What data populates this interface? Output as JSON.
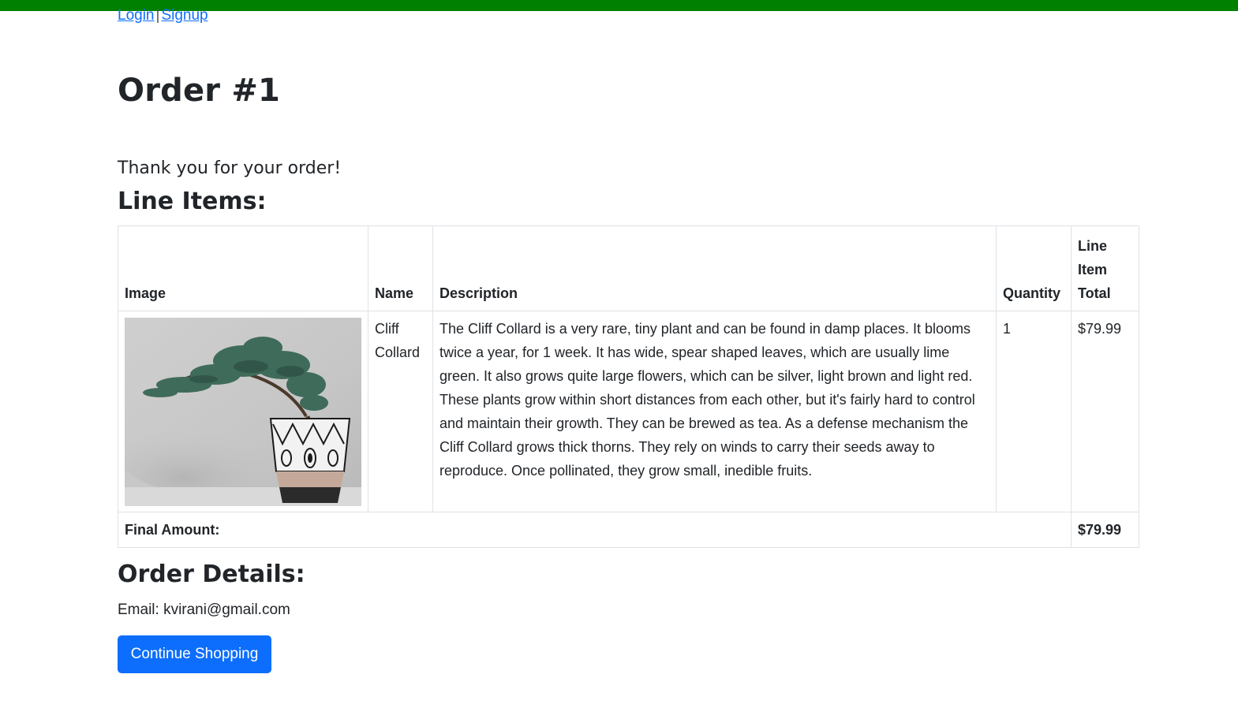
{
  "header": {
    "login_label": "Login",
    "separator": "|",
    "signup_label": "Signup",
    "bar_color": "#008000"
  },
  "page": {
    "title": "Order #1",
    "thanks_message": "Thank you for your order!",
    "line_items_heading": "Line Items:",
    "order_details_heading": "Order Details:"
  },
  "table": {
    "columns": [
      "Image",
      "Name",
      "Description",
      "Quantity",
      "Line Item Total"
    ],
    "rows": [
      {
        "image": "bonsai-plant-image",
        "name": "Cliff Collard",
        "description": "The Cliff Collard is a very rare, tiny plant and can be found in damp places. It blooms twice a year, for 1 week. It has wide, spear shaped leaves, which are usually lime green. It also grows quite large flowers, which can be silver, light brown and light red. These plants grow within short distances from each other, but it's fairly hard to control and maintain their growth. They can be brewed as tea. As a defense mechanism the Cliff Collard grows thick thorns. They rely on winds to carry their seeds away to reproduce. Once pollinated, they grow small, inedible fruits.",
        "quantity": "1",
        "total": "$79.99"
      }
    ],
    "final_label": "Final Amount:",
    "final_amount": "$79.99"
  },
  "details": {
    "email_line": "Email: kvirani@gmail.com"
  },
  "actions": {
    "continue_label": "Continue Shopping",
    "continue_color": "#0d6efd"
  }
}
